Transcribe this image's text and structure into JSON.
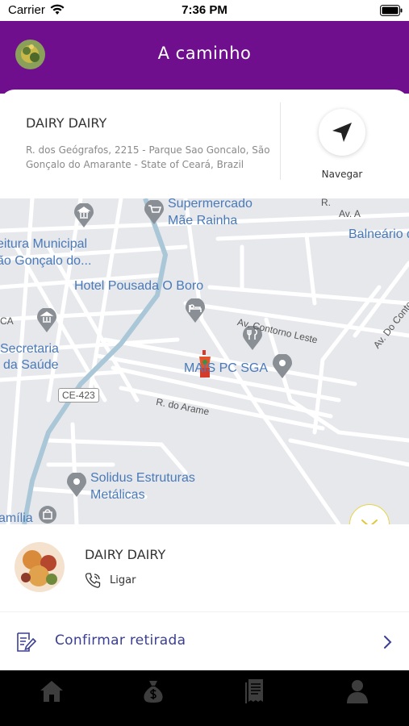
{
  "status_bar": {
    "carrier": "Carrier",
    "time": "7:36 PM"
  },
  "header": {
    "title": "A caminho"
  },
  "store_card": {
    "name": "DAIRY DAIRY",
    "address": "R. dos Geógrafos, 2215 - Parque Sao Goncalo, São Gonçalo do Amarante - State of Ceará, Brazil",
    "navigate_label": "Navegar"
  },
  "map": {
    "places": [
      {
        "key": "supermercado",
        "text": "Supermercado"
      },
      {
        "key": "mae_rainha",
        "text": "Mãe Rainha"
      },
      {
        "key": "prefeitura1",
        "text": "eitura Municipal"
      },
      {
        "key": "prefeitura2",
        "text": "ão Gonçalo do..."
      },
      {
        "key": "hotel",
        "text": "Hotel Pousada O Boro"
      },
      {
        "key": "secretaria1",
        "text": "Secretaria"
      },
      {
        "key": "secretaria2",
        "text": "da Saúde"
      },
      {
        "key": "mais_pc",
        "text": "MAIS PC SGA"
      },
      {
        "key": "balneario",
        "text": "Balneário d"
      },
      {
        "key": "solidus1",
        "text": "Solidus Estruturas"
      },
      {
        "key": "solidus2",
        "text": "Metálicas"
      },
      {
        "key": "familia",
        "text": "amília"
      }
    ],
    "streets": {
      "av_a": "Av. A",
      "contorno": "Av. Contorno Leste",
      "av_do_contorno": "Av. Do Contor",
      "rua_arame": "R. do Arame",
      "ce423": "CE-423",
      "ca": "CA",
      "r": "R."
    }
  },
  "merchant": {
    "name": "DAIRY DAIRY",
    "call_label": "Ligar"
  },
  "confirm": {
    "label": "Confirmar retirada"
  },
  "colors": {
    "header": "#6f0f8e",
    "accent_text": "#3b3f93",
    "tabbar": "#000000",
    "map_label": "#4a7ab8"
  },
  "tabs": [
    {
      "icon": "home-icon"
    },
    {
      "icon": "money-bag-icon"
    },
    {
      "icon": "receipt-icon"
    },
    {
      "icon": "user-icon"
    }
  ]
}
